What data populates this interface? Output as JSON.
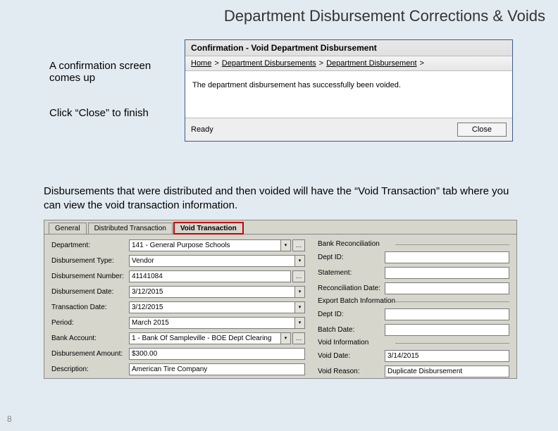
{
  "title": "Department Disbursement Corrections & Voids",
  "note1": "A confirmation screen comes up",
  "note2": "Click “Close” to finish",
  "dialog": {
    "title": "Confirmation - Void Department Disbursement",
    "crumbs": {
      "home": "Home",
      "s1": ">",
      "dd": "Department Disbursements",
      "s2": ">",
      "d": "Department Disbursement",
      "s3": ">"
    },
    "message": "The department disbursement has successfully been voided.",
    "status": "Ready",
    "close": "Close"
  },
  "para": "Disbursements that were distributed and then voided will have the “Void Transaction” tab where you can view the void transaction information.",
  "tabs": {
    "general": "General",
    "dist": "Distributed Transaction",
    "void": "Void Transaction"
  },
  "form": {
    "left": {
      "department_lbl": "Department:",
      "department_val": "141 - General Purpose Schools",
      "type_lbl": "Disbursement Type:",
      "type_val": "Vendor",
      "num_lbl": "Disbursement Number:",
      "num_val": "41141084",
      "ddate_lbl": "Disbursement Date:",
      "ddate_val": "3/12/2015",
      "tdate_lbl": "Transaction Date:",
      "tdate_val": "3/12/2015",
      "period_lbl": "Period:",
      "period_val": "March 2015",
      "bank_lbl": "Bank Account:",
      "bank_val": "1 - Bank Of Sampleville - BOE Dept Clearing",
      "amt_lbl": "Disbursement Amount:",
      "amt_val": "$300.00",
      "desc_lbl": "Description:",
      "desc_val": "American Tire Company"
    },
    "right": {
      "group1": "Bank Reconciliation",
      "depid_lbl": "Dept ID:",
      "stmt_lbl": "Statement:",
      "recdate_lbl": "Reconciliation Date:",
      "group2": "Export Batch Information",
      "deptid2_lbl": "Dept ID:",
      "batchdate_lbl": "Batch Date:",
      "group3": "Void Information",
      "voiddate_lbl": "Void Date:",
      "voiddate_val": "3/14/2015",
      "voidreason_lbl": "Void Reason:",
      "voidreason_val": "Duplicate Disbursement"
    }
  },
  "page_num": "8"
}
